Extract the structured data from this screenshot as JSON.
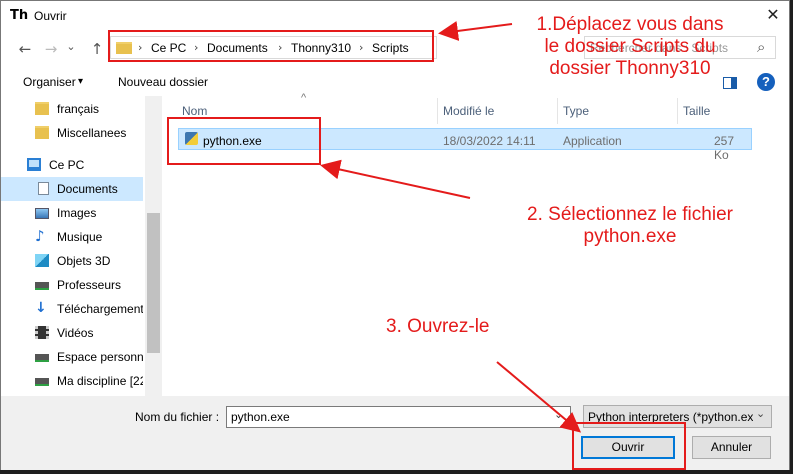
{
  "window": {
    "title": "Ouvrir",
    "close_glyph": "✕",
    "app_icon_glyph": "Th"
  },
  "nav": {
    "back": "←",
    "forward": "→",
    "dropdown": "⌄",
    "up": "↑"
  },
  "address": {
    "crumbs": [
      "Ce PC",
      "Documents",
      "Thonny310",
      "Scripts"
    ],
    "separator": "›",
    "search_placeholder": "Rechercher dans : Scripts",
    "search_glyph": "⌕"
  },
  "toolbar": {
    "organize": "Organiser",
    "organize_caret": "▾",
    "new_folder": "Nouveau dossier",
    "help": "?"
  },
  "sidebar": {
    "items": [
      {
        "label": "français",
        "icon": "folder-icon"
      },
      {
        "label": "Miscellanees",
        "icon": "folder-icon"
      },
      {
        "label": "Ce PC",
        "icon": "computer-icon"
      },
      {
        "label": "Documents",
        "icon": "documents-icon",
        "selected": true
      },
      {
        "label": "Images",
        "icon": "pictures-icon"
      },
      {
        "label": "Musique",
        "icon": "music-icon"
      },
      {
        "label": "Objets 3D",
        "icon": "3d-objects-icon"
      },
      {
        "label": "Professeurs",
        "icon": "network-drive-icon"
      },
      {
        "label": "Téléchargements",
        "icon": "download-icon"
      },
      {
        "label": "Vidéos",
        "icon": "videos-icon"
      },
      {
        "label": "Espace personnel",
        "icon": "network-drive-icon"
      },
      {
        "label": "Ma discipline [22",
        "icon": "network-drive-icon"
      }
    ]
  },
  "filelist": {
    "sort_caret": "^",
    "columns": [
      "Nom",
      "Modifié le",
      "Type",
      "Taille"
    ],
    "rows": [
      {
        "name": "python.exe",
        "modified": "18/03/2022 14:11",
        "type": "Application",
        "size": "257 Ko",
        "icon": "python-icon"
      }
    ]
  },
  "footer": {
    "filename_label": "Nom du fichier :",
    "filename_value": "python.exe",
    "filter_value": "Python interpreters (*python.ex",
    "open_button": "Ouvrir",
    "cancel_button": "Annuler",
    "dropdown_glyph": "⌄"
  },
  "annotations": {
    "step1": [
      "1.Déplacez vous dans",
      "le dossier Scripts du",
      "dossier Thonny310"
    ],
    "step2": [
      "2. Sélectionnez le fichier",
      "python.exe"
    ],
    "step3": "3. Ouvrez-le"
  },
  "colors": {
    "annotation_red": "#e41b1b",
    "selection": "#cce8ff",
    "accent": "#0078d7"
  }
}
